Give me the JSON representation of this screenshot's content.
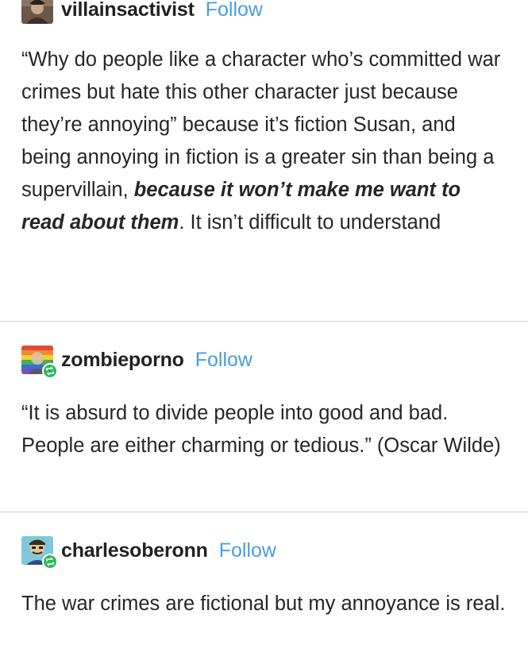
{
  "posts": [
    {
      "username": "villainsactivist",
      "follow_label": "Follow",
      "avatar_icon": "villain-avatar-icon",
      "text_before_emphasis": "“Why do people like a character who’s committed war crimes but hate this other character just because they’re annoying” because it’s fiction Susan, and being annoying in fiction is a greater sin than being a supervillain, ",
      "emphasis": "because it won’t make me want to read about them",
      "text_after_emphasis": ". It isn’t difficult to understand"
    },
    {
      "username": "zombieporno",
      "follow_label": "Follow",
      "avatar_icon": "rainbow-avatar-icon",
      "badge_icon": "reblog-icon",
      "text": "“It is absurd to divide people into good and bad. People are either charming or tedious.” (Oscar Wilde)"
    },
    {
      "username": "charlesoberonn",
      "follow_label": "Follow",
      "avatar_icon": "cartoon-avatar-icon",
      "badge_icon": "reblog-icon",
      "text": "The war crimes are fictional but my annoyance is real."
    }
  ],
  "colors": {
    "follow": "#4a9de0",
    "reblog_badge": "#2fb65a",
    "divider": "#cfcfcf"
  }
}
